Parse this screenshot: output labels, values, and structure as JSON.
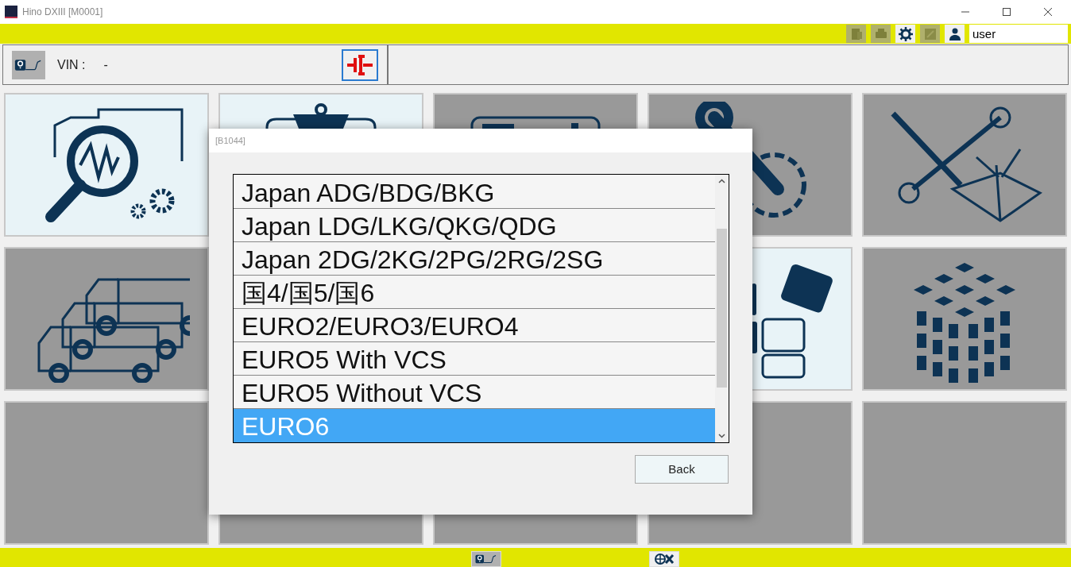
{
  "window": {
    "title": "Hino DXIII [M0001]"
  },
  "toolbar": {
    "buttons": [
      {
        "kind": "document",
        "disabled": true
      },
      {
        "kind": "printer",
        "disabled": true
      },
      {
        "kind": "settings",
        "disabled": false
      },
      {
        "kind": "edit",
        "disabled": true
      },
      {
        "kind": "user",
        "disabled": false
      }
    ],
    "user_field": {
      "value": "user"
    }
  },
  "header": {
    "vin_label": "VIN :",
    "vin_value": "-"
  },
  "tiles": [
    {
      "kind": "diagnosis",
      "enabled": true
    },
    {
      "kind": "clipboard",
      "enabled": true
    },
    {
      "kind": "window",
      "enabled": false
    },
    {
      "kind": "wrench-gear",
      "enabled": false
    },
    {
      "kind": "tools-book",
      "enabled": false
    },
    {
      "kind": "trucks",
      "enabled": false
    },
    {
      "kind": "blocks",
      "enabled": true
    },
    {
      "kind": "cube",
      "enabled": false
    },
    {
      "kind": "blank",
      "enabled": false
    },
    {
      "kind": "blank",
      "enabled": false
    },
    {
      "kind": "blank",
      "enabled": false
    },
    {
      "kind": "blank",
      "enabled": false
    },
    {
      "kind": "blank",
      "enabled": false
    }
  ],
  "dialog": {
    "title": "[B1044]",
    "items": [
      {
        "label": "Japan ADG/BDG/BKG",
        "selected": false
      },
      {
        "label": "Japan LDG/LKG/QKG/QDG",
        "selected": false
      },
      {
        "label": "Japan 2DG/2KG/2PG/2RG/2SG",
        "selected": false
      },
      {
        "label": "国4/国5/国6",
        "selected": false
      },
      {
        "label": "EURO2/EURO3/EURO4",
        "selected": false
      },
      {
        "label": "EURO5 With VCS",
        "selected": false
      },
      {
        "label": "EURO5 Without VCS",
        "selected": false
      },
      {
        "label": "EURO6",
        "selected": true
      }
    ],
    "back_button": "Back"
  }
}
